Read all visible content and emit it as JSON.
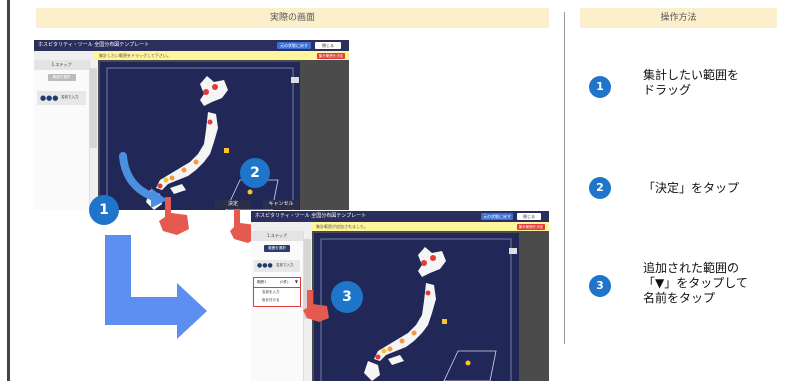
{
  "left_header": "実際の画面",
  "right_header": "操作方法",
  "screenshot1": {
    "title": "ホスピタリティ・ツール 全国分布図テンプレート",
    "yellow_bar_text": "集計したい範囲をドラッグして下さい。",
    "yellow_button": "集計範囲を決定",
    "btn_save": "元の状態に戻す",
    "btn_close": "閉じる",
    "side_header": "1.ステップ",
    "side_button": "範囲を選択",
    "side_item": "名前で入力"
  },
  "screenshot2": {
    "title": "ホスピタリティ・ツール 全国分布図テンプレート",
    "yellow_bar_text": "集計範囲が追加されました。",
    "yellow_button": "集計範囲を決定",
    "btn_save": "元の状態に戻す",
    "btn_close": "閉じる",
    "side_header": "1.ステップ",
    "side_button": "範囲を選択",
    "side_item": "名前で入力",
    "dropdown_value": "範囲1",
    "dropdown_count": "(0件)",
    "list_item_1": "名前を入力",
    "list_item_2": "色を付ける"
  },
  "decide_button": "決定",
  "cancel_button": "キャンセル",
  "steps": [
    {
      "number": "1",
      "text_line1": "集計したい範囲を",
      "text_line2": "ドラッグ",
      "text_line3": ""
    },
    {
      "number": "2",
      "text_line1": "「決定」をタップ",
      "text_line2": "",
      "text_line3": ""
    },
    {
      "number": "3",
      "text_line1": "追加された範囲の",
      "text_line2": "「▼」をタップして",
      "text_line3": "名前をタップ"
    }
  ],
  "badges": {
    "b1": "1",
    "b2": "2",
    "b3": "3"
  },
  "colors": {
    "accent_blue": "#1f75c9",
    "header_bg": "#fcefcc",
    "map_bg": "#212857",
    "japan": "#f5f5f5",
    "marker_red": "#e53935",
    "marker_orange": "#f29a3f",
    "marker_yellow": "#f6c42b",
    "hand": "#e55a4f"
  }
}
